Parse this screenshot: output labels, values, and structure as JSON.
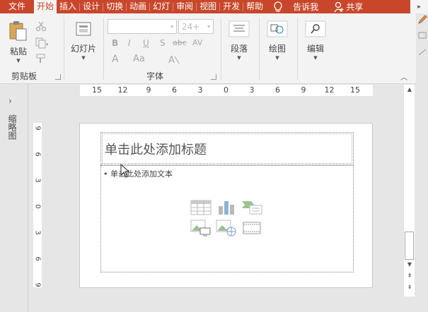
{
  "tabs": [
    {
      "label": "文件",
      "active": false
    },
    {
      "label": "开始",
      "active": true
    },
    {
      "label": "插入",
      "active": false
    },
    {
      "label": "设计",
      "active": false
    },
    {
      "label": "切换",
      "active": false
    },
    {
      "label": "动画",
      "active": false
    },
    {
      "label": "幻灯",
      "active": false
    },
    {
      "label": "审阅",
      "active": false
    },
    {
      "label": "视图",
      "active": false
    },
    {
      "label": "开发",
      "active": false
    },
    {
      "label": "帮助",
      "active": false
    }
  ],
  "tell_me": "告诉我",
  "share": "共享",
  "ribbon": {
    "clipboard": {
      "paste": "粘贴",
      "group_label": "剪贴板"
    },
    "slides": {
      "new_slide": "幻灯片"
    },
    "font": {
      "font_size": "24+",
      "group_label": "字体",
      "bold": "B",
      "italic": "I",
      "underline": "U",
      "shadow": "S",
      "strike": "abc",
      "spacing": "AV",
      "case": "Aa",
      "color": "A"
    },
    "paragraph": {
      "label": "段落"
    },
    "drawing": {
      "label": "绘图"
    },
    "editing": {
      "label": "编辑"
    }
  },
  "left_pane": {
    "label": "缩略图"
  },
  "hruler_ticks": [
    "15",
    "12",
    "9",
    "6",
    "3",
    "0",
    "3",
    "6",
    "9",
    "12",
    "15"
  ],
  "vruler_ticks": [
    "9",
    "6",
    "3",
    "0",
    "3",
    "6",
    "9"
  ],
  "slide": {
    "title_placeholder": "单击此处添加标题",
    "body_placeholder": "• 单击此处添加文本"
  },
  "colors": {
    "accent": "#c8472b",
    "ribbon_bg": "#f3f3f3",
    "canvas_bg": "#e6e6e6"
  }
}
